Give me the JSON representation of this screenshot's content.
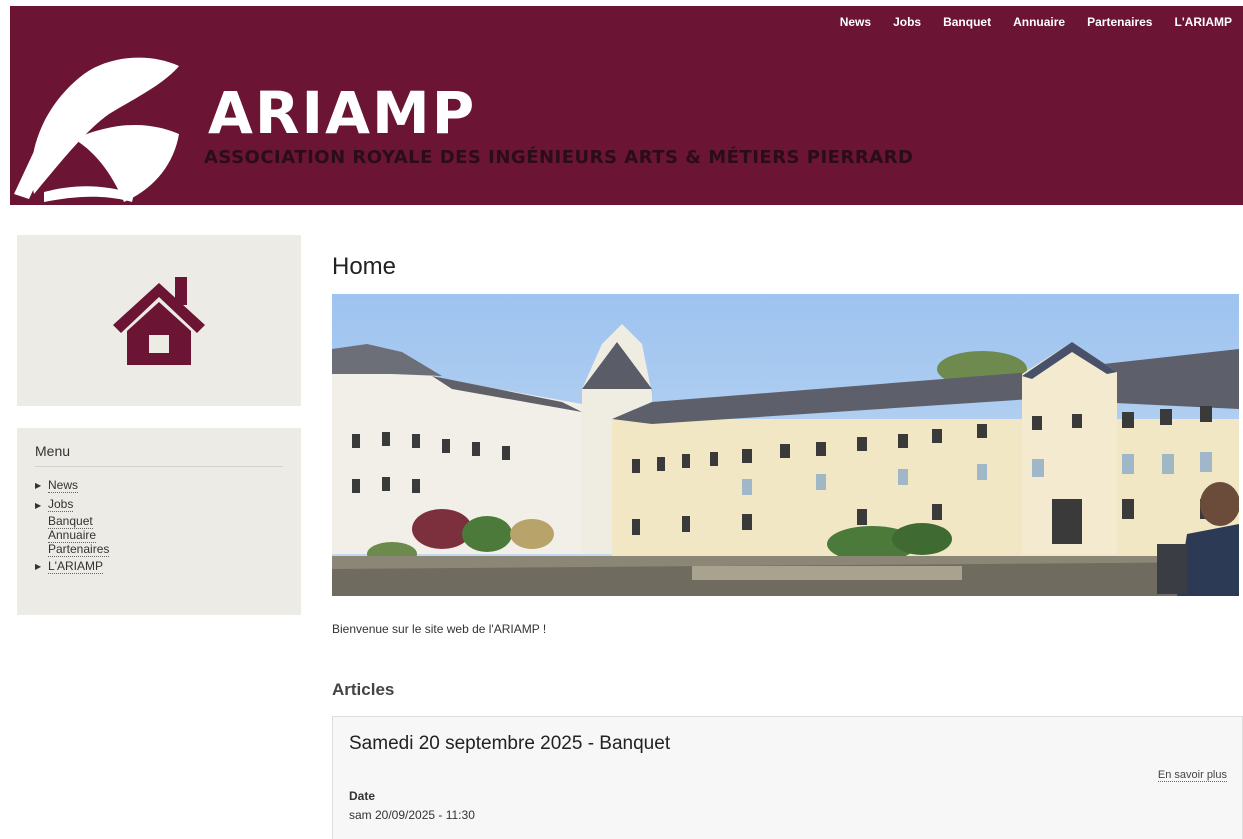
{
  "colors": {
    "brand": "#6b1434",
    "sidebar_bg": "#ecebe6",
    "article_bg": "#f7f7f7"
  },
  "header": {
    "nav": [
      "News",
      "Jobs",
      "Banquet",
      "Annuaire",
      "Partenaires",
      "L'ARIAMP"
    ],
    "logo_text": "ARIAMP",
    "tagline": "ASSOCIATION ROYALE DES INGÉNIEURS ARTS & MÉTIERS PIERRARD"
  },
  "sidebar": {
    "home_icon": "house-icon",
    "menu_title": "Menu",
    "items": [
      {
        "label": "News",
        "expandable": true
      },
      {
        "label": "Jobs",
        "expandable": true
      },
      {
        "label": "Banquet",
        "expandable": false
      },
      {
        "label": "Annuaire",
        "expandable": false
      },
      {
        "label": "Partenaires",
        "expandable": false
      },
      {
        "label": "L'ARIAMP",
        "expandable": true
      }
    ]
  },
  "main": {
    "title": "Home",
    "welcome": "Bienvenue sur le site web de l'ARIAMP !",
    "articles_title": "Articles",
    "article": {
      "title": "Samedi 20 septembre 2025 - Banquet",
      "read_more": "En savoir plus",
      "date_label": "Date",
      "date_value": "sam 20/09/2025 - 11:30"
    }
  }
}
